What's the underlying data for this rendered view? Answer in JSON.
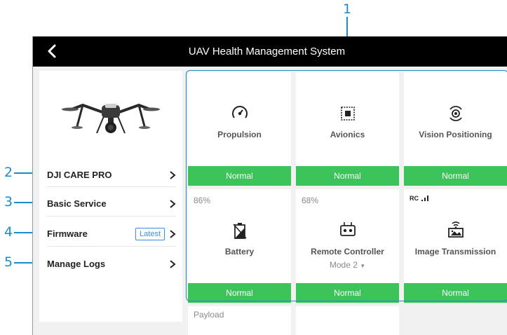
{
  "callouts": [
    "1",
    "2",
    "3",
    "4",
    "5"
  ],
  "header": {
    "title": "UAV Health Management System"
  },
  "menu": {
    "items": [
      {
        "label": "DJI CARE PRO"
      },
      {
        "label": "Basic Service"
      },
      {
        "label": "Firmware",
        "badge": "Latest"
      },
      {
        "label": "Manage Logs"
      }
    ]
  },
  "modules": [
    {
      "name": "Propulsion",
      "status": "Normal",
      "icon": "propulsion-gauge-icon"
    },
    {
      "name": "Avionics",
      "status": "Normal",
      "icon": "chip-icon"
    },
    {
      "name": "Vision Positioning",
      "status": "Normal",
      "icon": "vision-sensor-icon"
    },
    {
      "name": "Battery",
      "status": "Normal",
      "level": "86%",
      "icon": "battery-icon"
    },
    {
      "name": "Remote Controller",
      "status": "Normal",
      "level": "68%",
      "mode": "Mode 2",
      "icon": "remote-controller-icon"
    },
    {
      "name": "Image Transmission",
      "status": "Normal",
      "signal": "RC",
      "icon": "image-transmission-icon"
    }
  ],
  "payload": {
    "label": "Payload"
  },
  "colors": {
    "status_normal": "#3cc45a",
    "callout": "#1b8ccb",
    "topbar": "#000000",
    "badge": "#3a8ee6"
  }
}
